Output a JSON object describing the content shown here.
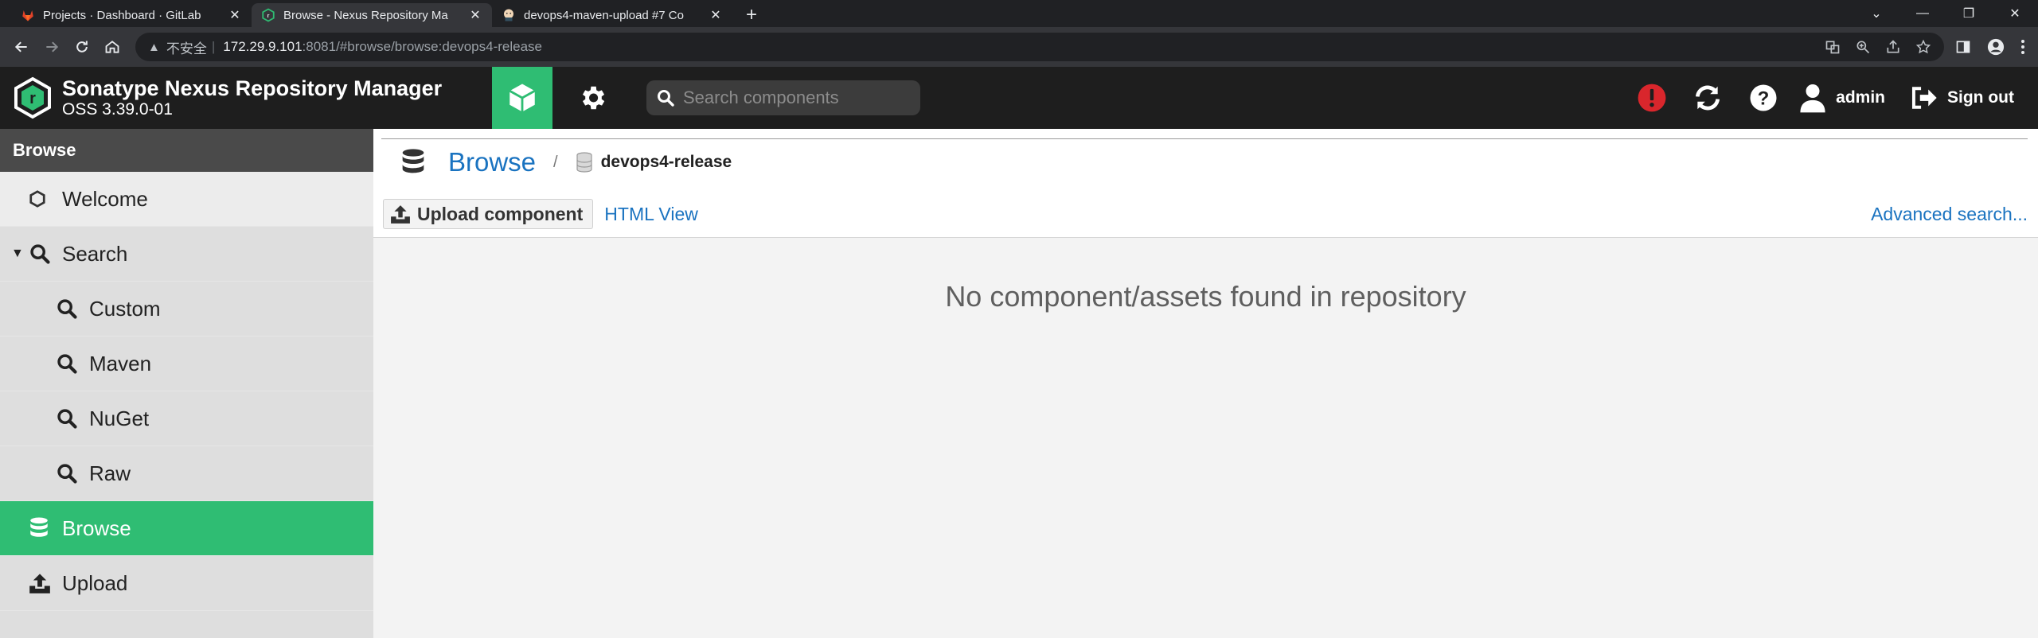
{
  "browser": {
    "tabs": [
      {
        "title": "Projects · Dashboard · GitLab",
        "active": false,
        "favicon": "gitlab-icon"
      },
      {
        "title": "Browse - Nexus Repository Ma",
        "active": true,
        "favicon": "nexus-icon"
      },
      {
        "title": "devops4-maven-upload #7 Co",
        "active": false,
        "favicon": "jenkins-icon"
      }
    ],
    "address": {
      "insecure_label": "不安全",
      "host": "172.29.9.101",
      "rest": ":8081/#browse/browse:devops4-release"
    }
  },
  "app": {
    "name": "Sonatype Nexus Repository Manager",
    "version": "OSS 3.39.0-01",
    "search_placeholder": "Search components",
    "username": "admin",
    "signout_label": "Sign out",
    "accent_color": "#2fbd73"
  },
  "sidebar": {
    "title": "Browse",
    "items": [
      {
        "label": "Welcome",
        "icon": "hexagon-icon"
      },
      {
        "label": "Search",
        "icon": "search-icon"
      },
      {
        "label": "Custom",
        "icon": "search-icon"
      },
      {
        "label": "Maven",
        "icon": "search-icon"
      },
      {
        "label": "NuGet",
        "icon": "search-icon"
      },
      {
        "label": "Raw",
        "icon": "search-icon"
      },
      {
        "label": "Browse",
        "icon": "database-icon",
        "selected": true
      },
      {
        "label": "Upload",
        "icon": "upload-icon"
      }
    ]
  },
  "main": {
    "breadcrumb": {
      "title": "Browse",
      "separator": "/",
      "repo": "devops4-release"
    },
    "toolbar": {
      "upload_label": "Upload component",
      "html_view_label": "HTML View",
      "advanced_search_label": "Advanced search..."
    },
    "empty_message": "No component/assets found in repository"
  }
}
